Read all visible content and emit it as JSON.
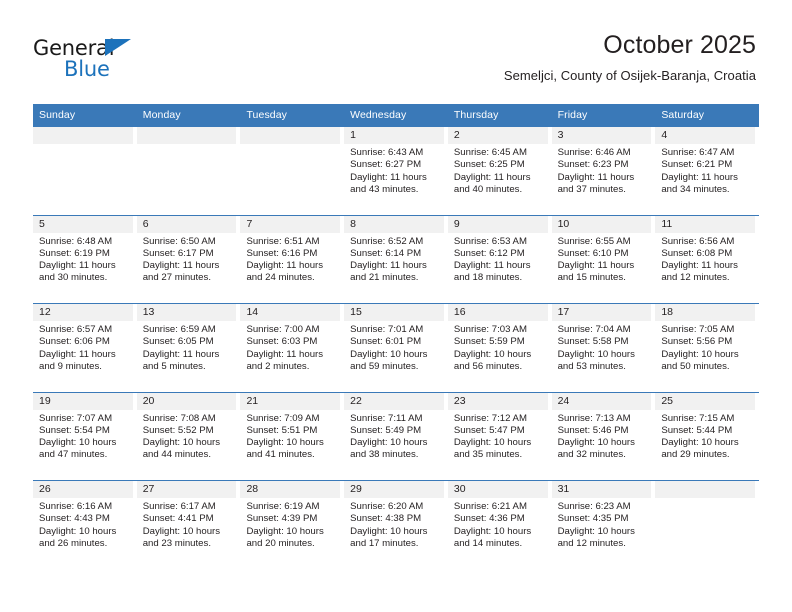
{
  "logo": {
    "word_one": "General",
    "word_two": "Blue",
    "triangle_icon": "triangle-icon",
    "brand_color": "#1c72bb"
  },
  "header": {
    "title": "October 2025",
    "subtitle": "Semeljci, County of Osijek-Baranja, Croatia"
  },
  "theme": {
    "header_row_bg": "#3a79b8",
    "day_band_bg": "#f1f1f1",
    "text_color": "#231f20"
  },
  "calendar": {
    "weekdays": [
      "Sunday",
      "Monday",
      "Tuesday",
      "Wednesday",
      "Thursday",
      "Friday",
      "Saturday"
    ],
    "weeks": [
      [
        {
          "day": "",
          "sunrise": "",
          "sunset": "",
          "daylight_line1": "",
          "daylight_line2": ""
        },
        {
          "day": "",
          "sunrise": "",
          "sunset": "",
          "daylight_line1": "",
          "daylight_line2": ""
        },
        {
          "day": "",
          "sunrise": "",
          "sunset": "",
          "daylight_line1": "",
          "daylight_line2": ""
        },
        {
          "day": "1",
          "sunrise": "Sunrise: 6:43 AM",
          "sunset": "Sunset: 6:27 PM",
          "daylight_line1": "Daylight: 11 hours",
          "daylight_line2": "and 43 minutes."
        },
        {
          "day": "2",
          "sunrise": "Sunrise: 6:45 AM",
          "sunset": "Sunset: 6:25 PM",
          "daylight_line1": "Daylight: 11 hours",
          "daylight_line2": "and 40 minutes."
        },
        {
          "day": "3",
          "sunrise": "Sunrise: 6:46 AM",
          "sunset": "Sunset: 6:23 PM",
          "daylight_line1": "Daylight: 11 hours",
          "daylight_line2": "and 37 minutes."
        },
        {
          "day": "4",
          "sunrise": "Sunrise: 6:47 AM",
          "sunset": "Sunset: 6:21 PM",
          "daylight_line1": "Daylight: 11 hours",
          "daylight_line2": "and 34 minutes."
        }
      ],
      [
        {
          "day": "5",
          "sunrise": "Sunrise: 6:48 AM",
          "sunset": "Sunset: 6:19 PM",
          "daylight_line1": "Daylight: 11 hours",
          "daylight_line2": "and 30 minutes."
        },
        {
          "day": "6",
          "sunrise": "Sunrise: 6:50 AM",
          "sunset": "Sunset: 6:17 PM",
          "daylight_line1": "Daylight: 11 hours",
          "daylight_line2": "and 27 minutes."
        },
        {
          "day": "7",
          "sunrise": "Sunrise: 6:51 AM",
          "sunset": "Sunset: 6:16 PM",
          "daylight_line1": "Daylight: 11 hours",
          "daylight_line2": "and 24 minutes."
        },
        {
          "day": "8",
          "sunrise": "Sunrise: 6:52 AM",
          "sunset": "Sunset: 6:14 PM",
          "daylight_line1": "Daylight: 11 hours",
          "daylight_line2": "and 21 minutes."
        },
        {
          "day": "9",
          "sunrise": "Sunrise: 6:53 AM",
          "sunset": "Sunset: 6:12 PM",
          "daylight_line1": "Daylight: 11 hours",
          "daylight_line2": "and 18 minutes."
        },
        {
          "day": "10",
          "sunrise": "Sunrise: 6:55 AM",
          "sunset": "Sunset: 6:10 PM",
          "daylight_line1": "Daylight: 11 hours",
          "daylight_line2": "and 15 minutes."
        },
        {
          "day": "11",
          "sunrise": "Sunrise: 6:56 AM",
          "sunset": "Sunset: 6:08 PM",
          "daylight_line1": "Daylight: 11 hours",
          "daylight_line2": "and 12 minutes."
        }
      ],
      [
        {
          "day": "12",
          "sunrise": "Sunrise: 6:57 AM",
          "sunset": "Sunset: 6:06 PM",
          "daylight_line1": "Daylight: 11 hours",
          "daylight_line2": "and 9 minutes."
        },
        {
          "day": "13",
          "sunrise": "Sunrise: 6:59 AM",
          "sunset": "Sunset: 6:05 PM",
          "daylight_line1": "Daylight: 11 hours",
          "daylight_line2": "and 5 minutes."
        },
        {
          "day": "14",
          "sunrise": "Sunrise: 7:00 AM",
          "sunset": "Sunset: 6:03 PM",
          "daylight_line1": "Daylight: 11 hours",
          "daylight_line2": "and 2 minutes."
        },
        {
          "day": "15",
          "sunrise": "Sunrise: 7:01 AM",
          "sunset": "Sunset: 6:01 PM",
          "daylight_line1": "Daylight: 10 hours",
          "daylight_line2": "and 59 minutes."
        },
        {
          "day": "16",
          "sunrise": "Sunrise: 7:03 AM",
          "sunset": "Sunset: 5:59 PM",
          "daylight_line1": "Daylight: 10 hours",
          "daylight_line2": "and 56 minutes."
        },
        {
          "day": "17",
          "sunrise": "Sunrise: 7:04 AM",
          "sunset": "Sunset: 5:58 PM",
          "daylight_line1": "Daylight: 10 hours",
          "daylight_line2": "and 53 minutes."
        },
        {
          "day": "18",
          "sunrise": "Sunrise: 7:05 AM",
          "sunset": "Sunset: 5:56 PM",
          "daylight_line1": "Daylight: 10 hours",
          "daylight_line2": "and 50 minutes."
        }
      ],
      [
        {
          "day": "19",
          "sunrise": "Sunrise: 7:07 AM",
          "sunset": "Sunset: 5:54 PM",
          "daylight_line1": "Daylight: 10 hours",
          "daylight_line2": "and 47 minutes."
        },
        {
          "day": "20",
          "sunrise": "Sunrise: 7:08 AM",
          "sunset": "Sunset: 5:52 PM",
          "daylight_line1": "Daylight: 10 hours",
          "daylight_line2": "and 44 minutes."
        },
        {
          "day": "21",
          "sunrise": "Sunrise: 7:09 AM",
          "sunset": "Sunset: 5:51 PM",
          "daylight_line1": "Daylight: 10 hours",
          "daylight_line2": "and 41 minutes."
        },
        {
          "day": "22",
          "sunrise": "Sunrise: 7:11 AM",
          "sunset": "Sunset: 5:49 PM",
          "daylight_line1": "Daylight: 10 hours",
          "daylight_line2": "and 38 minutes."
        },
        {
          "day": "23",
          "sunrise": "Sunrise: 7:12 AM",
          "sunset": "Sunset: 5:47 PM",
          "daylight_line1": "Daylight: 10 hours",
          "daylight_line2": "and 35 minutes."
        },
        {
          "day": "24",
          "sunrise": "Sunrise: 7:13 AM",
          "sunset": "Sunset: 5:46 PM",
          "daylight_line1": "Daylight: 10 hours",
          "daylight_line2": "and 32 minutes."
        },
        {
          "day": "25",
          "sunrise": "Sunrise: 7:15 AM",
          "sunset": "Sunset: 5:44 PM",
          "daylight_line1": "Daylight: 10 hours",
          "daylight_line2": "and 29 minutes."
        }
      ],
      [
        {
          "day": "26",
          "sunrise": "Sunrise: 6:16 AM",
          "sunset": "Sunset: 4:43 PM",
          "daylight_line1": "Daylight: 10 hours",
          "daylight_line2": "and 26 minutes."
        },
        {
          "day": "27",
          "sunrise": "Sunrise: 6:17 AM",
          "sunset": "Sunset: 4:41 PM",
          "daylight_line1": "Daylight: 10 hours",
          "daylight_line2": "and 23 minutes."
        },
        {
          "day": "28",
          "sunrise": "Sunrise: 6:19 AM",
          "sunset": "Sunset: 4:39 PM",
          "daylight_line1": "Daylight: 10 hours",
          "daylight_line2": "and 20 minutes."
        },
        {
          "day": "29",
          "sunrise": "Sunrise: 6:20 AM",
          "sunset": "Sunset: 4:38 PM",
          "daylight_line1": "Daylight: 10 hours",
          "daylight_line2": "and 17 minutes."
        },
        {
          "day": "30",
          "sunrise": "Sunrise: 6:21 AM",
          "sunset": "Sunset: 4:36 PM",
          "daylight_line1": "Daylight: 10 hours",
          "daylight_line2": "and 14 minutes."
        },
        {
          "day": "31",
          "sunrise": "Sunrise: 6:23 AM",
          "sunset": "Sunset: 4:35 PM",
          "daylight_line1": "Daylight: 10 hours",
          "daylight_line2": "and 12 minutes."
        },
        {
          "day": "",
          "sunrise": "",
          "sunset": "",
          "daylight_line1": "",
          "daylight_line2": ""
        }
      ]
    ]
  }
}
